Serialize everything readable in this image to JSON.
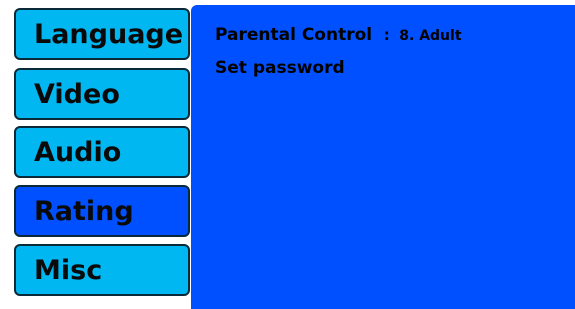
{
  "menu": {
    "items": [
      {
        "label": "Language",
        "active": false
      },
      {
        "label": "Video",
        "active": false
      },
      {
        "label": "Audio",
        "active": false
      },
      {
        "label": "Rating",
        "active": true
      },
      {
        "label": "Misc",
        "active": false
      }
    ]
  },
  "panel": {
    "parental_control": {
      "label": "Parental Control",
      "separator": ":",
      "value": "8. Adult"
    },
    "set_password": {
      "label": "Set password"
    }
  },
  "colors": {
    "menu_item_bg": "#00b7f1",
    "active_bg": "#0050ff",
    "panel_bg": "#0050ff"
  }
}
